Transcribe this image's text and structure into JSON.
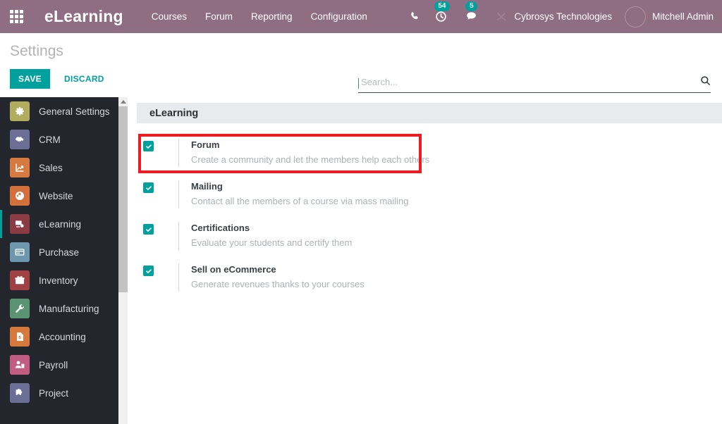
{
  "navbar": {
    "apps_icon": "apps-grid-icon",
    "brand": "eLearning",
    "menu": [
      {
        "label": "Courses"
      },
      {
        "label": "Forum"
      },
      {
        "label": "Reporting"
      },
      {
        "label": "Configuration"
      }
    ],
    "icons": {
      "phone": "phone-icon",
      "activity": "clock-activity-icon",
      "messages": "chat-bubble-icon",
      "tools": "tools-icon"
    },
    "activity_count": "54",
    "message_count": "5",
    "company": "Cybrosys Technologies",
    "user": "Mitchell Admin",
    "avatar": "user-avatar"
  },
  "control_panel": {
    "title": "Settings",
    "save_label": "SAVE",
    "discard_label": "DISCARD"
  },
  "search": {
    "value": "",
    "placeholder": "Search...",
    "icon": "search-icon"
  },
  "sidebar": {
    "items": [
      {
        "label": "General Settings",
        "icon": "gear-icon",
        "color": "#b2ac5e",
        "active": false
      },
      {
        "label": "CRM",
        "icon": "handshake-icon",
        "color": "#6b6f96",
        "active": false
      },
      {
        "label": "Sales",
        "icon": "chart-up-icon",
        "color": "#d77a42",
        "active": false
      },
      {
        "label": "Website",
        "icon": "globe-icon",
        "color": "#d4703c",
        "active": false
      },
      {
        "label": "eLearning",
        "icon": "elearning-icon",
        "color": "#8b3b44",
        "active": true
      },
      {
        "label": "Purchase",
        "icon": "card-icon",
        "color": "#6d97ad",
        "active": false
      },
      {
        "label": "Inventory",
        "icon": "box-icon",
        "color": "#9e4044",
        "active": false
      },
      {
        "label": "Manufacturing",
        "icon": "wrench-icon",
        "color": "#5a9472",
        "active": false
      },
      {
        "label": "Accounting",
        "icon": "invoice-icon",
        "color": "#d57a3c",
        "active": false
      },
      {
        "label": "Payroll",
        "icon": "employee-icon",
        "color": "#c25d82",
        "active": false
      },
      {
        "label": "Project",
        "icon": "puzzle-icon",
        "color": "#6b6f96",
        "active": false
      }
    ]
  },
  "main": {
    "panel_title": "eLearning",
    "settings": [
      {
        "title": "Forum",
        "description": "Create a community and let the members help each others",
        "checked": true
      },
      {
        "title": "Mailing",
        "description": "Contact all the members of a course via mass mailing",
        "checked": true
      },
      {
        "title": "Certifications",
        "description": "Evaluate your students and certify them",
        "checked": true
      },
      {
        "title": "Sell on eCommerce",
        "description": "Generate revenues thanks to your courses",
        "checked": true
      }
    ]
  },
  "annotation": {
    "color": "#ed1c24",
    "target": "Forum"
  },
  "colors": {
    "navbar": "#8f6e84",
    "accent": "#00a09d",
    "sidebar": "#23262d",
    "panel_header": "#e7ebee"
  }
}
